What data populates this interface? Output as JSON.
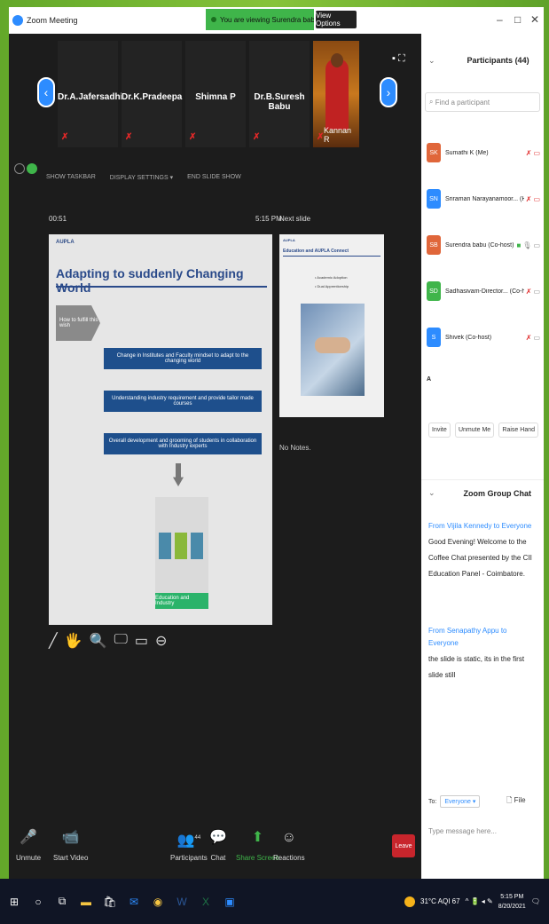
{
  "window": {
    "title": "Zoom Meeting",
    "share_banner": "You are viewing Surendra babu's screen",
    "view_options": "View Options",
    "controls": [
      "–",
      "□",
      "✕"
    ]
  },
  "thumbs": [
    {
      "name": "Dr.A.Jafersadhiq"
    },
    {
      "name": "Dr.K.Pradeepa"
    },
    {
      "name": "Shimna P"
    },
    {
      "name": "Dr.B.Suresh Babu"
    },
    {
      "name": "Kannan R"
    }
  ],
  "presenter_controls": [
    "SHOW TASKBAR",
    "DISPLAY SETTINGS ▾",
    "END SLIDE SHOW"
  ],
  "presenter": {
    "timer": "00:51",
    "time": "5:15 PM",
    "next_slide_label": "Next slide",
    "notes": "No Notes."
  },
  "slide": {
    "logo": "AUPLA",
    "title": "Adapting to suddenly Changing World",
    "arrow_text": "How to fulfill this wish",
    "boxes": [
      "Change in Institutes and Faculty mindset to adapt to the changing world",
      "Understanding industry requirement and provide tailor made courses",
      "Overall development and grooming of students in collaboration with Industry experts"
    ],
    "green_label": "Education and Industry"
  },
  "next_slide": {
    "logo": "AUPLA",
    "title": "Education and AUPLA Connect",
    "bullets": [
      "• Academic Adoption",
      "• Dual Apprenticeship"
    ]
  },
  "annotation_tools": [
    "╱",
    "🖐",
    "🔍",
    "🖵",
    "▭",
    "⊖"
  ],
  "bottom_bar": {
    "unmute": "Unmute",
    "start_video": "Start Video",
    "participants": "Participants",
    "participant_count": "44",
    "chat": "Chat",
    "share_screen": "Share Screen",
    "reactions": "Reactions",
    "leave": "Leave"
  },
  "participants_panel": {
    "title": "Participants (44)",
    "search_placeholder": "Find a participant",
    "items": [
      {
        "initials": "SK",
        "name": "Sumathi K (Me)",
        "color": "#e0663a"
      },
      {
        "initials": "SN",
        "name": "Sriraman Narayanamoor... (Host)",
        "color": "#2d8cff"
      },
      {
        "initials": "SB",
        "name": "Surendra babu (Co-host)",
        "color": "#e0663a"
      },
      {
        "initials": "SD",
        "name": "Sadhasivam-Director... (Co-host)",
        "color": "#3fb54a"
      },
      {
        "initials": "S",
        "name": "Shivek (Co-host)",
        "color": "#2d8cff"
      },
      {
        "initials": "A",
        "name": "",
        "color": "#333333"
      }
    ],
    "buttons": [
      "Invite",
      "Unmute Me",
      "Raise Hand"
    ]
  },
  "chat_panel": {
    "title": "Zoom Group Chat",
    "messages": [
      {
        "from": "From Vijila Kennedy to Everyone",
        "text": "Good Evening! Welcome to the Coffee Chat presented by the CII Education Panel - Coimbatore."
      },
      {
        "from": "From Senapathy Appu to Everyone",
        "text": "the slide is static, its in the first slide still"
      }
    ],
    "to_label": "To:",
    "to_value": "Everyone ▾",
    "file_label": "File",
    "type_placeholder": "Type message here..."
  },
  "taskbar": {
    "weather": "31°C AQI 67",
    "time": "5:15 PM",
    "date": "8/20/2021"
  }
}
